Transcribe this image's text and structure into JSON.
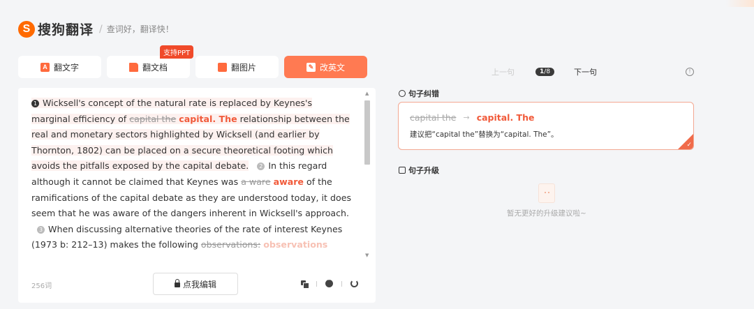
{
  "brand": {
    "logo_letter": "S",
    "name": "搜狗翻译",
    "separator": "/",
    "slogan": "查词好，翻译快！"
  },
  "tabs": [
    {
      "label": "翻文字",
      "icon": "text-translate-icon",
      "active": false
    },
    {
      "label": "翻文档",
      "icon": "document-icon",
      "active": false
    },
    {
      "label": "翻图片",
      "icon": "image-icon",
      "active": false
    },
    {
      "label": "改英文",
      "icon": "edit-english-icon",
      "active": true
    }
  ],
  "ppt_badge": "支持PPT",
  "editor": {
    "s1_num": "1",
    "s1_a": "Wicksell's concept of the natural rate is replaced by Keynes's marginal efficiency of ",
    "s1_del": "capital the",
    "s1_ins": "capital. The",
    "s1_b": " relationship between the real and monetary sectors highlighted by Wicksell (and earlier by Thornton, 1802) can be placed on a secure theoretical footing which avoids the pitfalls exposed by the capital debate.",
    "s2_num": "2",
    "s2_a": "In this regard although it cannot be claimed that Keynes was ",
    "s2_del": "a ware",
    "s2_ins": "aware",
    "s2_b": " of the ramifications of the capital debate as they are understood today, it does seem that he was aware of the dangers inherent in Wicksell's approach.",
    "s3_num": "3",
    "s3_a": "When discussing alternative theories of the rate of interest Keynes (1973 b: 212–13) makes the following ",
    "s3_del": "observations:",
    "s3_faded": "observations",
    "word_count": "256词",
    "edit_button": "点我编辑",
    "tools": [
      "copy-icon",
      "feedback-icon",
      "refresh-icon"
    ]
  },
  "nav": {
    "prev": "上一句",
    "current": "1",
    "total": "8",
    "next": "下一句",
    "info_icon": "info-icon"
  },
  "correction": {
    "title": "句子纠错",
    "old": "capital the",
    "arrow": "→",
    "new": "capital. The",
    "suggestion": "建议把“capital the”替换为“capital. The”。",
    "check": "✓"
  },
  "upgrade": {
    "title": "句子升级",
    "empty_text": "暂无更好的升级建议啦~"
  },
  "colors": {
    "accent": "#ff7a52",
    "error_red": "#f15a3a",
    "badge": "#f04a2a"
  }
}
